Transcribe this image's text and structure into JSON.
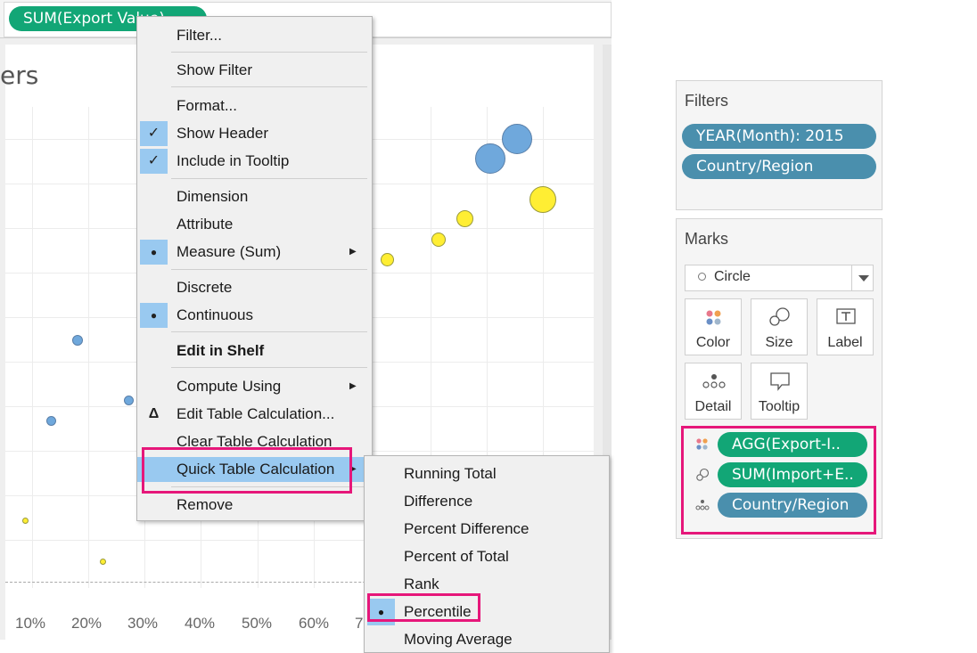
{
  "columns_shelf": {
    "pill_label": "SUM(Export Value)"
  },
  "viz": {
    "title_fragment": "ers",
    "x_axis_ticks": [
      "10%",
      "20%",
      "30%",
      "40%",
      "50%",
      "60%",
      "7"
    ]
  },
  "context_menu": {
    "items": [
      {
        "label": "Filter...",
        "state": "none"
      },
      {
        "label": "Show Filter",
        "state": "none"
      },
      {
        "label": "Format...",
        "state": "none"
      },
      {
        "label": "Show Header",
        "state": "check"
      },
      {
        "label": "Include in Tooltip",
        "state": "check"
      },
      {
        "label": "Dimension",
        "state": "none"
      },
      {
        "label": "Attribute",
        "state": "none"
      },
      {
        "label": "Measure (Sum)",
        "state": "dot",
        "submenu": true
      },
      {
        "label": "Discrete",
        "state": "none"
      },
      {
        "label": "Continuous",
        "state": "dot"
      },
      {
        "label": "Edit in Shelf",
        "state": "none",
        "bold": true
      },
      {
        "label": "Compute Using",
        "state": "none",
        "submenu": true
      },
      {
        "label": "Edit Table Calculation...",
        "state": "delta"
      },
      {
        "label": "Clear Table Calculation",
        "state": "none"
      },
      {
        "label": "Quick Table Calculation",
        "state": "highlight",
        "submenu": true
      },
      {
        "label": "Remove",
        "state": "none"
      }
    ],
    "check_glyph": "✓",
    "dot_glyph": "●",
    "delta_glyph": "Δ",
    "arrow_glyph": "▶"
  },
  "quick_table_submenu": {
    "items": [
      {
        "label": "Running Total"
      },
      {
        "label": "Difference"
      },
      {
        "label": "Percent Difference"
      },
      {
        "label": "Percent of Total"
      },
      {
        "label": "Rank"
      },
      {
        "label": "Percentile",
        "selected": true
      },
      {
        "label": "Moving Average"
      }
    ]
  },
  "filters_card": {
    "title": "Filters",
    "pills": [
      "YEAR(Month): 2015",
      "Country/Region"
    ]
  },
  "marks_card": {
    "title": "Marks",
    "mark_type": "Circle",
    "buttons": [
      {
        "label": "Color",
        "icon": "color-icon"
      },
      {
        "label": "Size",
        "icon": "size-icon"
      },
      {
        "label": "Label",
        "icon": "label-icon"
      },
      {
        "label": "Detail",
        "icon": "detail-icon"
      },
      {
        "label": "Tooltip",
        "icon": "tooltip-icon"
      }
    ],
    "fields": [
      {
        "label": "AGG(Export-I..",
        "kind": "color",
        "pill_color": "green"
      },
      {
        "label": "SUM(Import+E..",
        "kind": "size",
        "pill_color": "green"
      },
      {
        "label": "Country/Region",
        "kind": "detail",
        "pill_color": "blue"
      }
    ]
  },
  "colors": {
    "pill_green": "#12a676",
    "pill_blue": "#4a8fad",
    "highlight_box": "#e6177a",
    "menu_selection": "#99c9f0"
  }
}
